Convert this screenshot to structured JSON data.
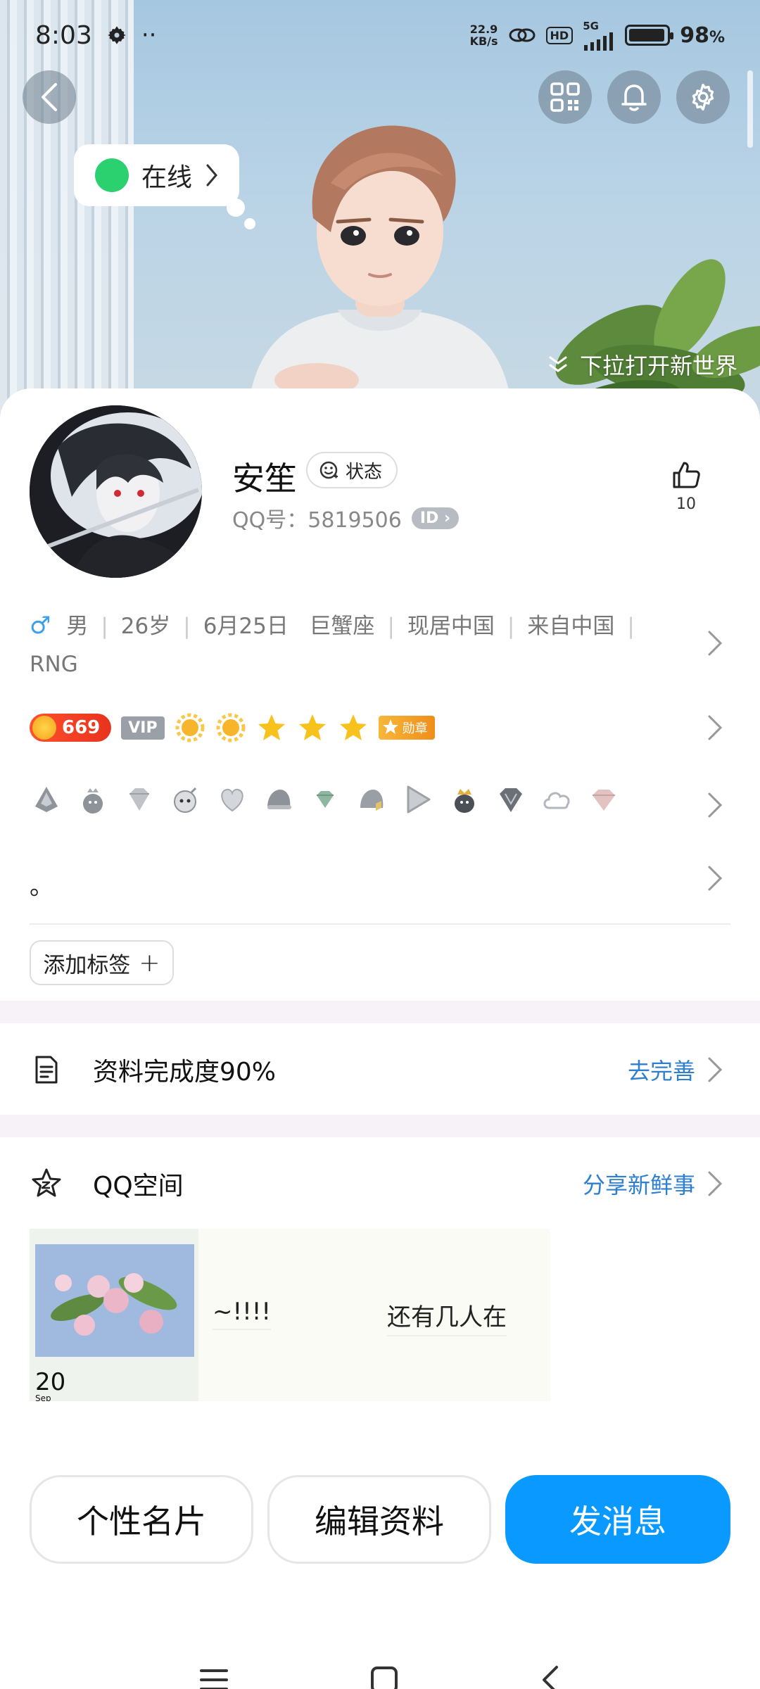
{
  "status_bar": {
    "time": "8:03",
    "extra": "··",
    "net_speed_value": "22.9",
    "net_speed_unit": "KB/s",
    "hd": "HD",
    "signal_label": "5G",
    "battery_percent": "98",
    "battery_unit": "%"
  },
  "hero": {
    "online_status": "在线",
    "pull_hint": "下拉打开新世界"
  },
  "profile": {
    "nickname": "安笙",
    "status_chip": "状态",
    "qq_label": "QQ号：",
    "qq_number": "5819506",
    "id_badge": "ID",
    "like_count": "10"
  },
  "info": {
    "gender_symbol": "♂",
    "gender": "男",
    "age": "26岁",
    "birthday": "6月25日",
    "zodiac": "巨蟹座",
    "residence": "现居中国",
    "hometown": "来自中国",
    "extra": "RNG"
  },
  "level": {
    "points": "669",
    "vip": "VIP",
    "medal": "勋章"
  },
  "motto": "。",
  "add_tag": {
    "label": "添加标签",
    "plus": "+"
  },
  "completeness": {
    "label": "资料完成度90%",
    "action": "去完善"
  },
  "qzone": {
    "title": "QQ空间",
    "action": "分享新鲜事",
    "thumb_date": "20",
    "thumb_month": "Sep",
    "post1": "~!!!!",
    "post2": "还有几人在"
  },
  "bottom_buttons": {
    "card": "个性名片",
    "edit": "编辑资料",
    "message": "发消息"
  },
  "colors": {
    "primary": "#0a99ff",
    "link": "#2f7fd0",
    "online": "#2bd16f",
    "points_pill": "#e8331d"
  }
}
